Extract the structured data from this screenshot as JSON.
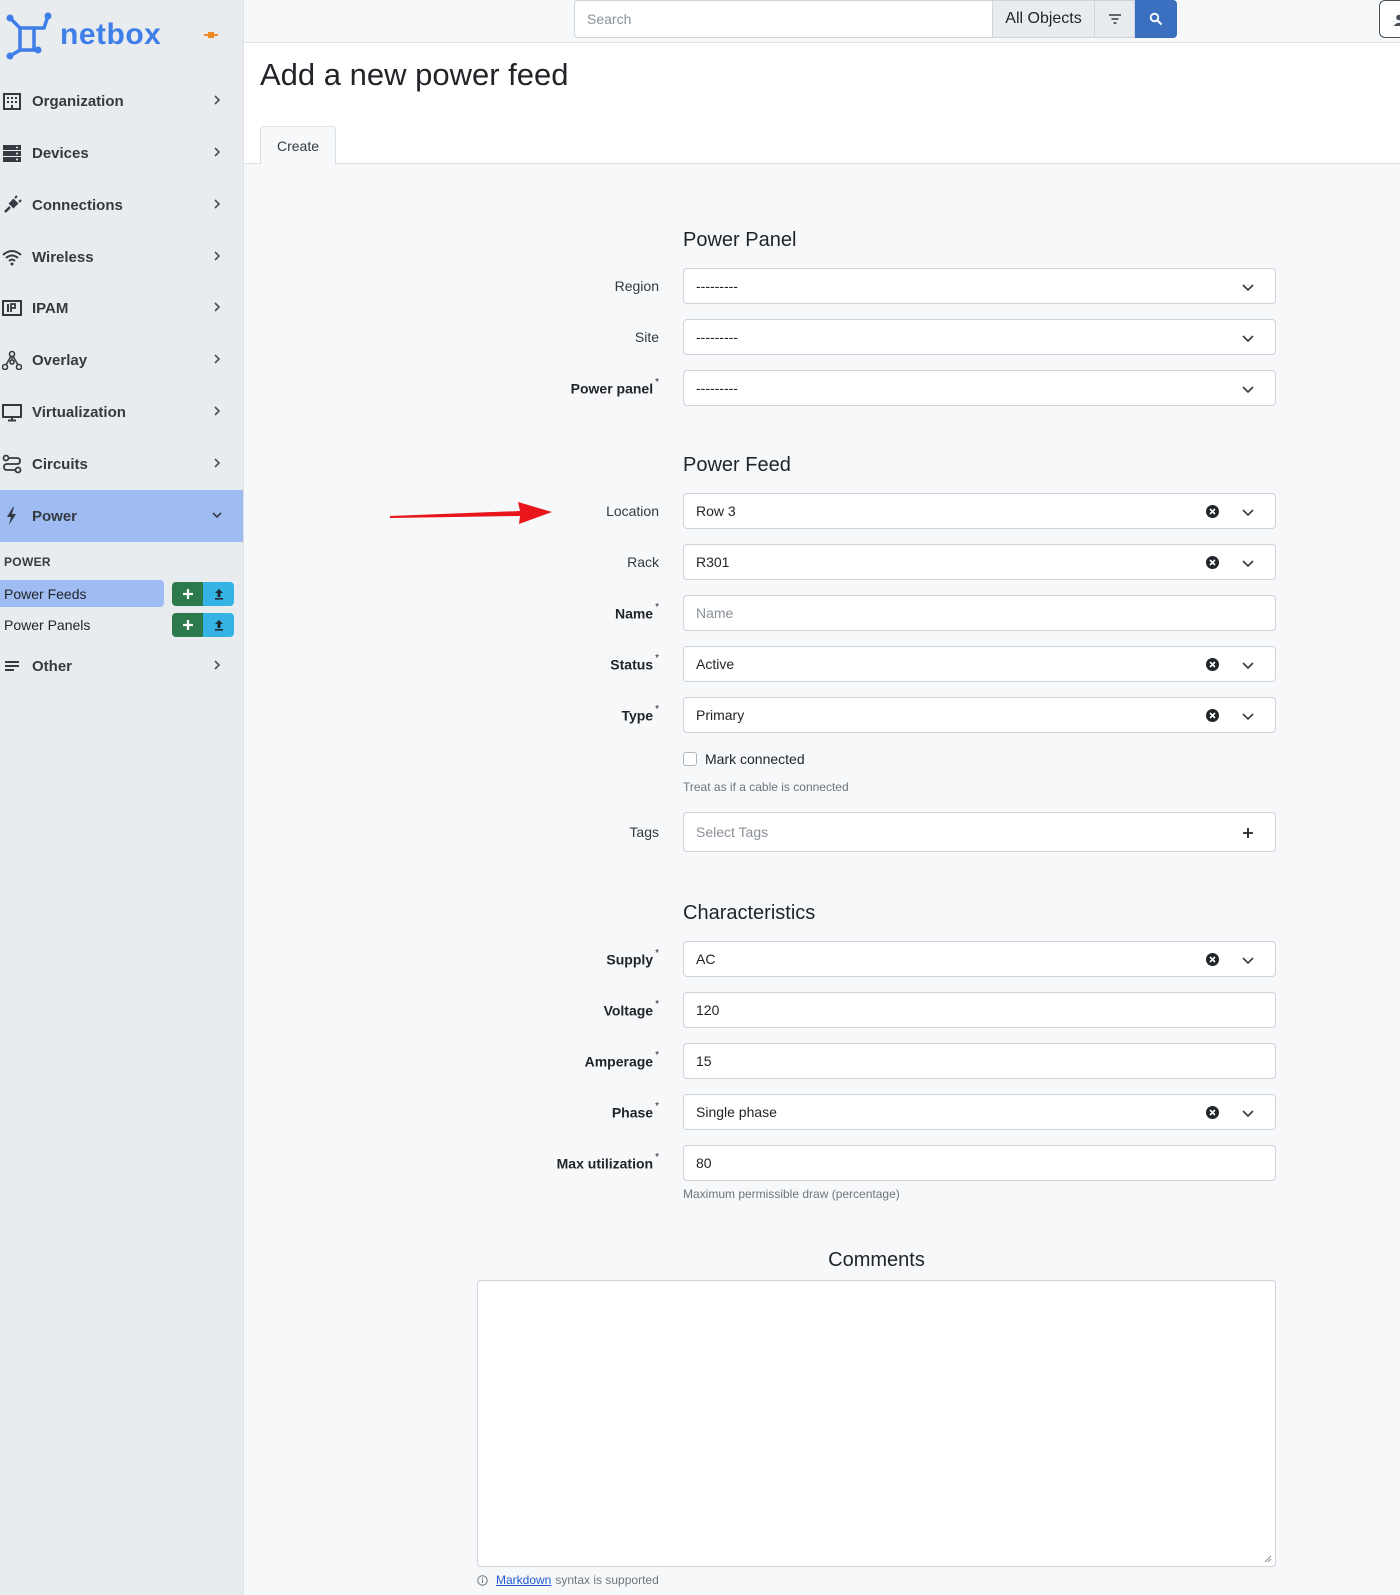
{
  "brand": {
    "name": "netbox"
  },
  "sidebar": {
    "items": [
      {
        "label": "Organization"
      },
      {
        "label": "Devices"
      },
      {
        "label": "Connections"
      },
      {
        "label": "Wireless"
      },
      {
        "label": "IPAM"
      },
      {
        "label": "Overlay"
      },
      {
        "label": "Virtualization"
      },
      {
        "label": "Circuits"
      },
      {
        "label": "Power"
      },
      {
        "label": "Other"
      }
    ],
    "active": "Power",
    "section_title": "POWER",
    "subitems": [
      {
        "label": "Power Feeds"
      },
      {
        "label": "Power Panels"
      }
    ],
    "colors": {
      "accent": "#9ebcf2",
      "add": "#2c7a4b",
      "import": "#34b3e4"
    }
  },
  "topbar": {
    "search_placeholder": "Search",
    "scope": "All Objects"
  },
  "page": {
    "title": "Add a new power feed",
    "tab": "Create"
  },
  "form": {
    "power_panel": {
      "heading": "Power Panel",
      "region": {
        "label": "Region",
        "value": "---------"
      },
      "site": {
        "label": "Site",
        "value": "---------"
      },
      "power_panel": {
        "label": "Power panel",
        "value": "---------"
      }
    },
    "power_feed": {
      "heading": "Power Feed",
      "location": {
        "label": "Location",
        "value": "Row 3"
      },
      "rack": {
        "label": "Rack",
        "value": "R301"
      },
      "name": {
        "label": "Name",
        "placeholder": "Name"
      },
      "status": {
        "label": "Status",
        "value": "Active"
      },
      "type": {
        "label": "Type",
        "value": "Primary"
      },
      "mark_connected": {
        "label": "Mark connected",
        "help": "Treat as if a cable is connected"
      },
      "tags": {
        "label": "Tags",
        "placeholder": "Select Tags"
      }
    },
    "characteristics": {
      "heading": "Characteristics",
      "supply": {
        "label": "Supply",
        "value": "AC"
      },
      "voltage": {
        "label": "Voltage",
        "value": "120"
      },
      "amperage": {
        "label": "Amperage",
        "value": "15"
      },
      "phase": {
        "label": "Phase",
        "value": "Single phase"
      },
      "max_utilization": {
        "label": "Max utilization",
        "value": "80",
        "help": "Maximum permissible draw (percentage)"
      }
    },
    "required_mark": "*",
    "comments": {
      "heading": "Comments",
      "link": "Markdown",
      "note": "syntax is supported"
    }
  },
  "annotation": {
    "arrow_color": "#e8161b"
  }
}
